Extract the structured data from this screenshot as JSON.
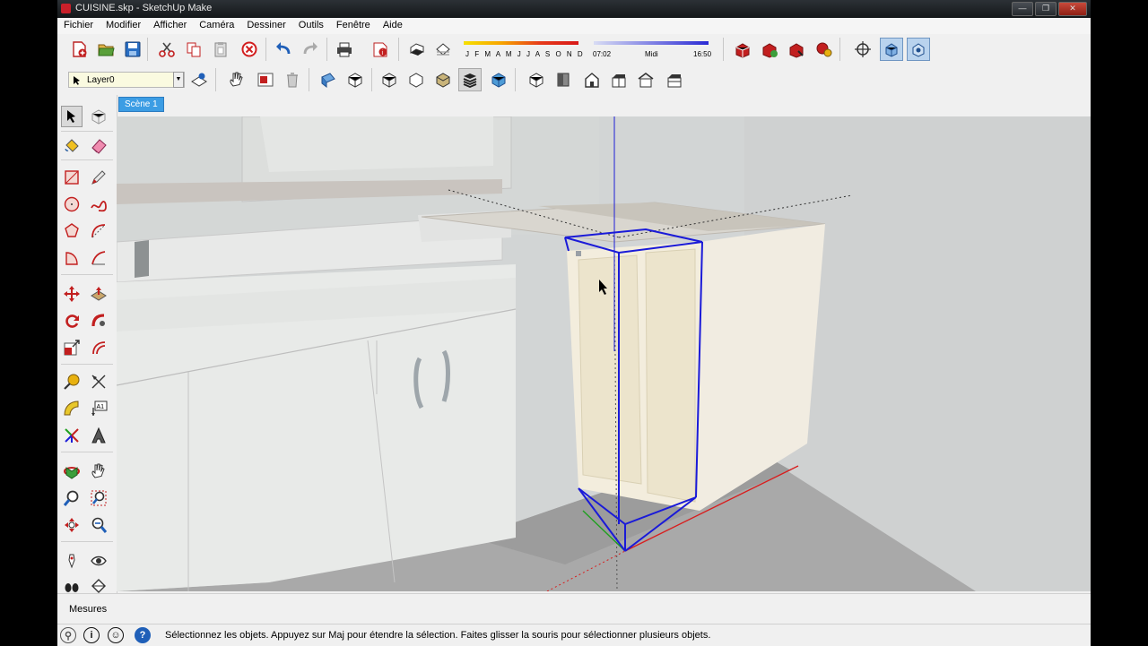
{
  "window": {
    "title": "CUISINE.skp - SketchUp Make"
  },
  "menu": [
    "Fichier",
    "Modifier",
    "Afficher",
    "Caméra",
    "Dessiner",
    "Outils",
    "Fenêtre",
    "Aide"
  ],
  "shadow": {
    "months": "J F M A M J J A S O N D",
    "time_start": "07:02",
    "time_mid": "Midi",
    "time_end": "16:50"
  },
  "layer": {
    "current": "Layer0"
  },
  "scene": {
    "tab": "Scène 1"
  },
  "measures": {
    "label": "Mesures"
  },
  "status": {
    "message": "Sélectionnez les objets. Appuyez sur Maj pour étendre la sélection. Faites glisser la souris pour sélectionner plusieurs objets."
  },
  "icons": {
    "toolbar1": [
      "new-file-icon",
      "open-file-icon",
      "save-icon",
      "cut-icon",
      "copy-icon",
      "paste-icon",
      "delete-icon",
      "undo-icon",
      "redo-icon",
      "print-icon",
      "model-info-icon",
      "shadows-icon",
      "fog-icon"
    ],
    "toolbar1_right": [
      "3d-warehouse-icon",
      "share-model-icon",
      "get-models-icon",
      "extension-warehouse-icon",
      "position-camera-icon",
      "walk-view-icon",
      "look-around-icon"
    ],
    "toolbar2": [
      "select-arrow-icon",
      "layer-manager-icon",
      "hand-tool-icon",
      "component-icon",
      "trash-icon",
      "section-plane-icon",
      "section-display-icon",
      "xray-icon",
      "wireframe-icon",
      "hidden-line-icon",
      "shaded-icon",
      "shaded-textures-icon",
      "monochrome-icon",
      "iso-view-icon",
      "top-view-icon",
      "front-view-icon",
      "right-view-icon",
      "back-view-icon",
      "left-view-icon"
    ],
    "tools_left": [
      "select-icon",
      "component-tool-icon",
      "paint-bucket-icon",
      "eraser-icon",
      "rectangle-icon",
      "pencil-icon",
      "circle-icon",
      "freehand-icon",
      "polygon-icon",
      "arc-icon",
      "pie-icon",
      "two-point-arc-icon",
      "move-icon",
      "push-pull-icon",
      "rotate-icon",
      "follow-me-icon",
      "scale-icon",
      "offset-icon",
      "tape-measure-icon",
      "dimension-icon",
      "protractor-icon",
      "text-icon",
      "axes-icon",
      "3d-text-icon",
      "orbit-icon",
      "pan-icon",
      "zoom-icon",
      "zoom-window-icon",
      "zoom-extents-icon",
      "previous-view-icon",
      "position-camera-icon",
      "look-around-icon",
      "walk-icon",
      "section-icon"
    ],
    "status_icons": [
      "geolocation-icon",
      "credits-icon",
      "user-icon",
      "help-icon"
    ]
  },
  "colors": {
    "scene_tab": "#3c9de4",
    "selection": "#1a1ad8",
    "axis_red": "#d81e1e",
    "axis_green": "#1ea01e",
    "axis_blue": "#1e1ed8",
    "sky": "#d2d5d5"
  }
}
